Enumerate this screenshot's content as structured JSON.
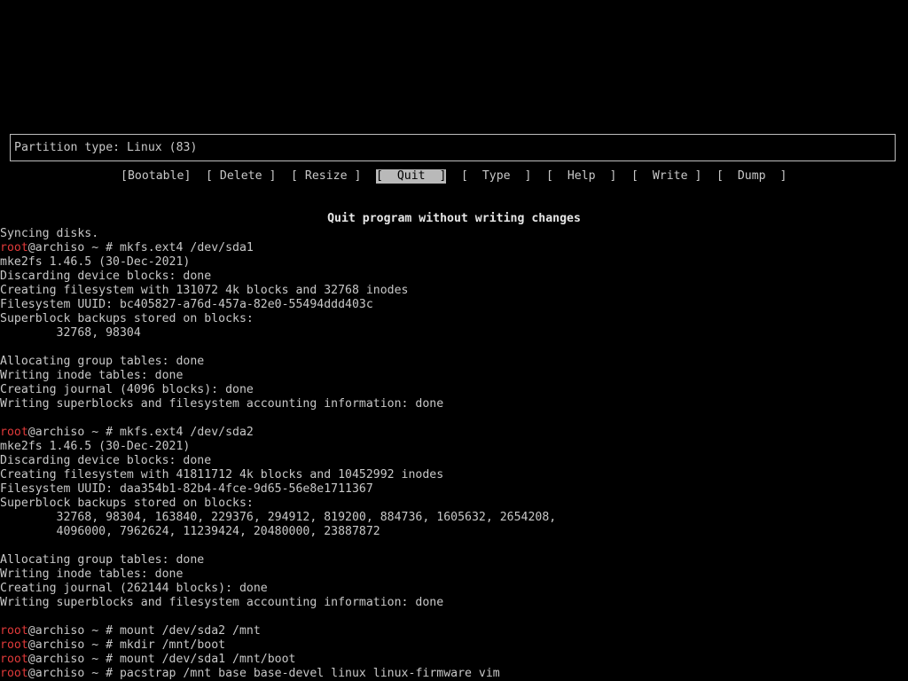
{
  "partition_box": {
    "text": "Partition type: Linux (83)"
  },
  "menu": {
    "items": [
      {
        "label": "[Bootable]",
        "selected": false
      },
      {
        "label": "[ Delete ]",
        "selected": false
      },
      {
        "label": "[ Resize ]",
        "selected": false
      },
      {
        "label": "[  Quit  ]",
        "selected": true
      },
      {
        "label": "[  Type  ]",
        "selected": false
      },
      {
        "label": "[  Help  ]",
        "selected": false
      },
      {
        "label": "[  Write ]",
        "selected": false
      },
      {
        "label": "[  Dump  ]",
        "selected": false
      }
    ]
  },
  "hint": "Quit program without writing changes",
  "colors": {
    "background": "#000000",
    "text": "#c8c8c8",
    "prompt_user": "#e03a3a",
    "selection_bg": "#b9b9b9"
  },
  "console": {
    "lines": [
      {
        "text": "Syncing disks."
      },
      {
        "user": "root",
        "text": "@archiso ~ # mkfs.ext4 /dev/sda1"
      },
      {
        "text": "mke2fs 1.46.5 (30-Dec-2021)"
      },
      {
        "text": "Discarding device blocks: done"
      },
      {
        "text": "Creating filesystem with 131072 4k blocks and 32768 inodes"
      },
      {
        "text": "Filesystem UUID: bc405827-a76d-457a-82e0-55494ddd403c"
      },
      {
        "text": "Superblock backups stored on blocks:"
      },
      {
        "text": "        32768, 98304"
      },
      {
        "text": ""
      },
      {
        "text": "Allocating group tables: done"
      },
      {
        "text": "Writing inode tables: done"
      },
      {
        "text": "Creating journal (4096 blocks): done"
      },
      {
        "text": "Writing superblocks and filesystem accounting information: done"
      },
      {
        "text": ""
      },
      {
        "user": "root",
        "text": "@archiso ~ # mkfs.ext4 /dev/sda2"
      },
      {
        "text": "mke2fs 1.46.5 (30-Dec-2021)"
      },
      {
        "text": "Discarding device blocks: done"
      },
      {
        "text": "Creating filesystem with 41811712 4k blocks and 10452992 inodes"
      },
      {
        "text": "Filesystem UUID: daa354b1-82b4-4fce-9d65-56e8e1711367"
      },
      {
        "text": "Superblock backups stored on blocks:"
      },
      {
        "text": "        32768, 98304, 163840, 229376, 294912, 819200, 884736, 1605632, 2654208,"
      },
      {
        "text": "        4096000, 7962624, 11239424, 20480000, 23887872"
      },
      {
        "text": ""
      },
      {
        "text": "Allocating group tables: done"
      },
      {
        "text": "Writing inode tables: done"
      },
      {
        "text": "Creating journal (262144 blocks): done"
      },
      {
        "text": "Writing superblocks and filesystem accounting information: done"
      },
      {
        "text": ""
      },
      {
        "user": "root",
        "text": "@archiso ~ # mount /dev/sda2 /mnt"
      },
      {
        "user": "root",
        "text": "@archiso ~ # mkdir /mnt/boot"
      },
      {
        "user": "root",
        "text": "@archiso ~ # mount /dev/sda1 /mnt/boot"
      },
      {
        "user": "root",
        "text": "@archiso ~ # pacstrap /mnt base base-devel linux linux-firmware vim"
      }
    ]
  }
}
